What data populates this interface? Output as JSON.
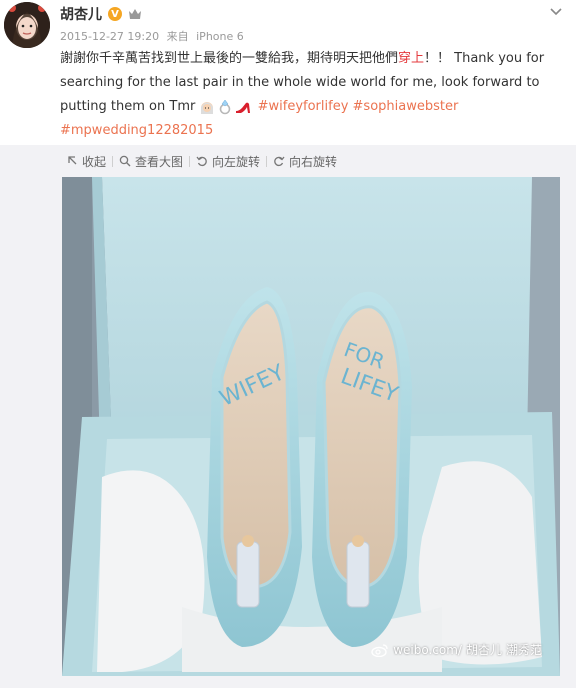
{
  "post": {
    "username": "胡杏儿",
    "verified_badge": "V",
    "timestamp": "2015-12-27 19:20",
    "source_prefix": "来自",
    "source": "iPhone 6",
    "text_part1": "謝謝你千辛萬苦找到世上最後的一雙給我，期待明天把他們",
    "text_highlight": "穿上",
    "text_part2": "！！ Thank you for searching for the last pair in the whole wide world for me, look forward to putting them on Tmr",
    "hashtags": [
      "#wifeyforlifey",
      "#sophiawebster",
      "#mpwedding12282015"
    ]
  },
  "toolbar": {
    "collapse": "收起",
    "view_large": "查看大图",
    "rotate_left": "向左旋转",
    "rotate_right": "向右旋转"
  },
  "photo": {
    "sole_left_text": "WIFEY",
    "sole_right_text_1": "FOR",
    "sole_right_text_2": "LIFEY",
    "watermark_site": "weibo.com/",
    "watermark_user": "胡杏儿",
    "watermark_extra": "潮秀范"
  },
  "icons": {
    "verified": "verified-v-icon",
    "vip": "vip-icon",
    "menu": "chevron-down-icon",
    "collapse": "collapse-arrow-icon",
    "view_large": "magnifier-icon",
    "rotate_left": "rotate-left-icon",
    "rotate_right": "rotate-right-icon",
    "weibo": "weibo-logo-icon"
  },
  "colors": {
    "link": "#eb7350",
    "highlight": "#e4393c",
    "badge": "#f5a623",
    "panel": "#f2f2f5"
  }
}
